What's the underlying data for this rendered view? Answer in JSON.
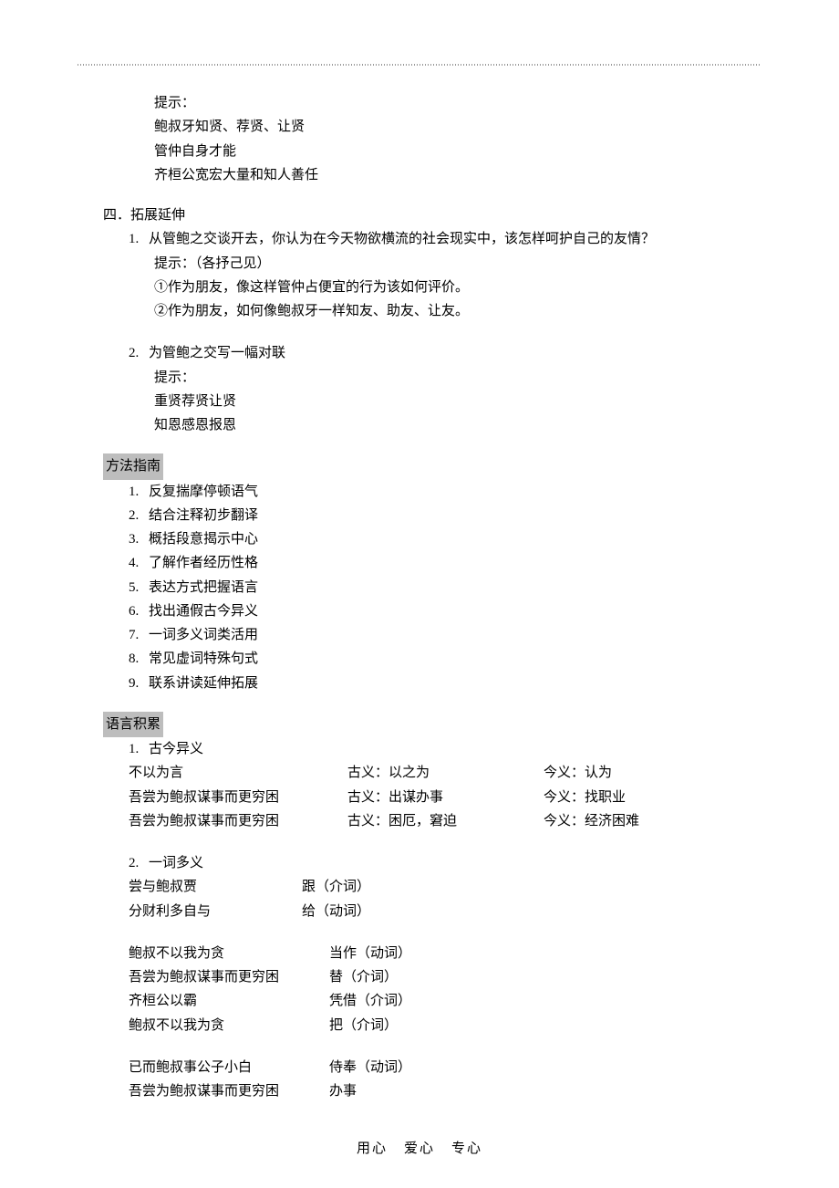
{
  "hints_block": {
    "label": "提示：",
    "lines": [
      "鲍叔牙知贤、荐贤、让贤",
      "管仲自身才能",
      "齐桓公宽宏大量和知人善任"
    ]
  },
  "section4": {
    "title": "四．拓展延伸",
    "item1": {
      "num": "1.",
      "text": "从管鲍之交谈开去，你认为在今天物欲横流的社会现实中，该怎样呵护自己的友情？",
      "hint_label": "提示：（各抒己见）",
      "sub1": "①作为朋友，像这样管仲占便宜的行为该如何评价。",
      "sub2": "②作为朋友，如何像鲍叔牙一样知友、助友、让友。"
    },
    "item2": {
      "num": "2.",
      "text": "为管鲍之交写一幅对联",
      "hint_label": "提示：",
      "line1": "重贤荐贤让贤",
      "line2": "知恩感恩报恩"
    }
  },
  "method": {
    "title": "方法指南",
    "items": [
      {
        "num": "1.",
        "text": "反复揣摩停顿语气"
      },
      {
        "num": "2.",
        "text": "结合注释初步翻译"
      },
      {
        "num": "3.",
        "text": "概括段意揭示中心"
      },
      {
        "num": "4.",
        "text": "了解作者经历性格"
      },
      {
        "num": "5.",
        "text": "表达方式把握语言"
      },
      {
        "num": "6.",
        "text": "找出通假古今异义"
      },
      {
        "num": "7.",
        "text": "一词多义词类活用"
      },
      {
        "num": "8.",
        "text": "常见虚词特殊句式"
      },
      {
        "num": "9.",
        "text": "联系讲读延伸拓展"
      }
    ]
  },
  "language": {
    "title": "语言积累",
    "part1": {
      "num": "1.",
      "label": "古今异义",
      "rows": [
        {
          "c1": "不以为言",
          "c2": "古义：以之为",
          "c3": "今义：认为"
        },
        {
          "c1": "吾尝为鲍叔谋事而更穷困",
          "c2": "古义：出谋办事",
          "c3": "今义：找职业"
        },
        {
          "c1": "吾尝为鲍叔谋事而更穷困",
          "c2": "古义：困厄，窘迫",
          "c3": "今义：经济困难"
        }
      ]
    },
    "part2": {
      "num": "2.",
      "label": "一词多义",
      "group1": [
        {
          "left": "尝与鲍叔贾",
          "right": "跟（介词）"
        },
        {
          "left": "分财利多自与",
          "right": "给（动词）"
        }
      ],
      "group2": [
        {
          "left": "鲍叔不以我为贪",
          "right": "当作（动词）"
        },
        {
          "left": "吾尝为鲍叔谋事而更穷困",
          "right": "替（介词）"
        },
        {
          "left": "齐桓公以霸",
          "right": "凭借（介词）"
        },
        {
          "left": "鲍叔不以我为贪",
          "right": "把（介词）"
        }
      ],
      "group3": [
        {
          "left": "已而鲍叔事公子小白",
          "right": "侍奉（动词）"
        },
        {
          "left": "吾尝为鲍叔谋事而更穷困",
          "right": "办事"
        }
      ]
    }
  },
  "footer": {
    "a": "用心",
    "b": "爱心",
    "c": "专心"
  }
}
